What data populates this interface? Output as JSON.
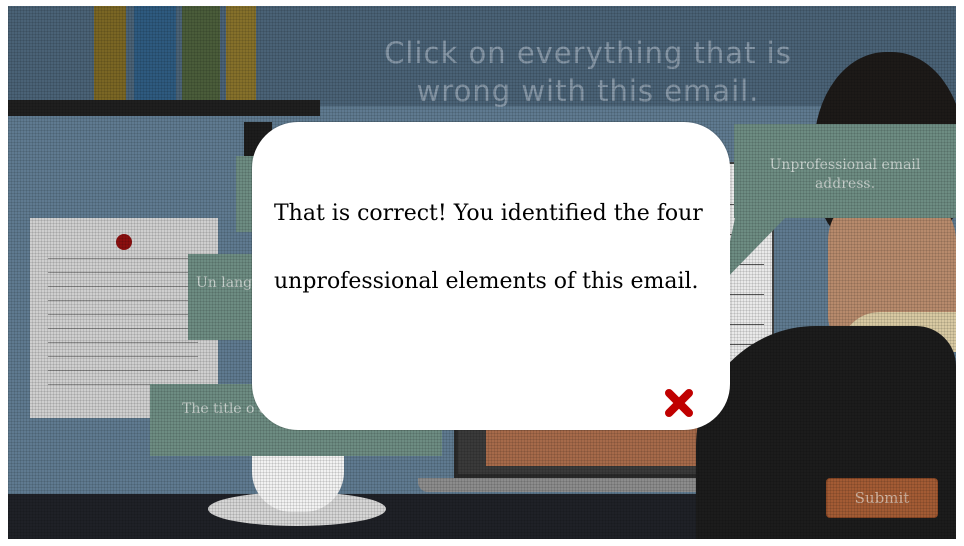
{
  "instruction": {
    "line1": "Click on everything that is",
    "line2": "wrong with this email."
  },
  "feedback_tips": {
    "email_address": "Unprofessional email address.",
    "language": "Un langua c",
    "title": "The title o ambiguous."
  },
  "submit_label": "Submit",
  "modal": {
    "message": "That is correct! You identified the four unprofessional elements of this email.",
    "close_icon": "close-x-icon",
    "close_color": "#c00000"
  },
  "colors": {
    "tip_background": "#6d8c82",
    "submit_background": "#a35b34"
  }
}
